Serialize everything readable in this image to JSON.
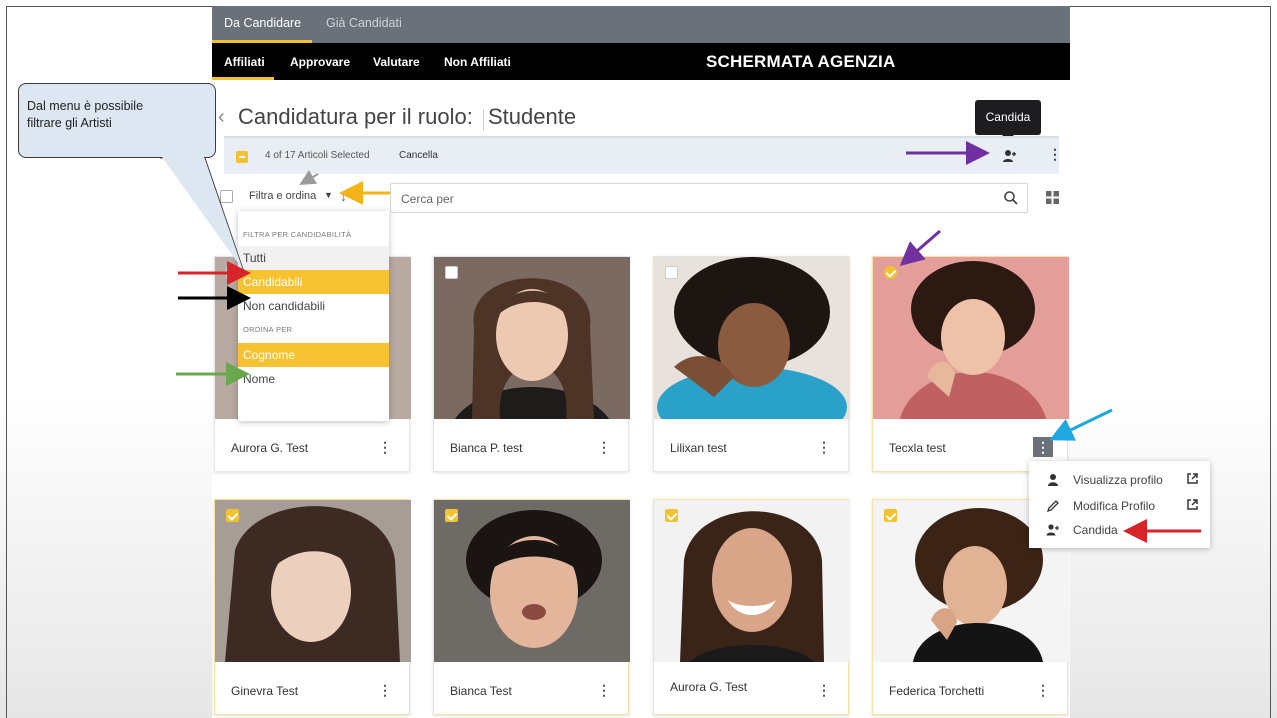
{
  "top_tabs": [
    "Da Candidare",
    "Già Candidati"
  ],
  "sub_tabs": [
    "Affiliati",
    "Approvare",
    "Valutare",
    "Non Affiliati"
  ],
  "agency_label": "SCHERMATA AGENZIA",
  "page_title": "Candidatura per il ruolo:",
  "role": "Studente",
  "selection": {
    "count_text": "4 of 17 Articoli Selected",
    "cancel": "Cancella"
  },
  "tooltip": "Candida",
  "filter": {
    "label": "Filtra e ordina",
    "search_placeholder": "Cerca per"
  },
  "dropdown": {
    "filter_header": "FILTRA PER CANDIDABILITÀ",
    "filter_options": [
      "Tutti",
      "Candidabili",
      "Non candidabili"
    ],
    "sort_header": "ORDINA PER",
    "sort_options": [
      "Cognome",
      "Nome"
    ]
  },
  "cards": [
    {
      "name": "Aurora G. Test",
      "selected": false
    },
    {
      "name": "Bianca P. test",
      "selected": false
    },
    {
      "name": "Lilixan test",
      "selected": false
    },
    {
      "name": "Tecxla test",
      "selected": true
    },
    {
      "name": "Ginevra Test",
      "selected": true
    },
    {
      "name": "Bianca Test",
      "selected": true
    },
    {
      "name": "Aurora G. Test",
      "selected": true
    },
    {
      "name": "Federica Torchetti",
      "selected": true
    }
  ],
  "context_menu": [
    "Visualizza profilo",
    "Modifica Profilo",
    "Candida"
  ],
  "callout": {
    "line1": "Dal menu è possibile",
    "line2": "filtrare gli Artisti"
  },
  "colors": {
    "accent": "#f2c230",
    "topbar": "#6b7178",
    "subbar": "#000000",
    "callout_bg": "#dde7f2",
    "arrow_red": "#d9232a",
    "arrow_black": "#000000",
    "arrow_green": "#6aa84f",
    "arrow_purple": "#7030a0",
    "arrow_orange": "#f2b418",
    "arrow_cyan": "#1ea7e1",
    "arrow_grey": "#9a9a9a"
  }
}
